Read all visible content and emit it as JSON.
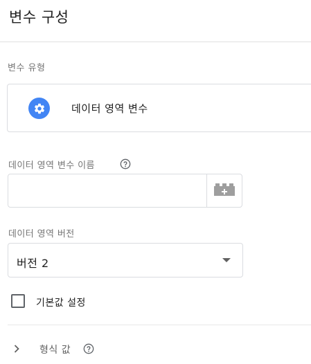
{
  "panel": {
    "title": "변수 구성"
  },
  "variable_type": {
    "section_label": "변수 유형",
    "selected_type": "데이터 영역 변수",
    "icon": "gear-icon",
    "icon_color": "#4285f4"
  },
  "data_layer_name": {
    "label": "데이터 영역 변수 이름",
    "value": "",
    "help_icon": "help-circle-icon",
    "picker_icon": "variable-brick-icon"
  },
  "data_layer_version": {
    "label": "데이터 영역 버전",
    "selected": "버전 2",
    "dropdown_icon": "dropdown-arrow-icon"
  },
  "default_value": {
    "label": "기본값 설정",
    "checked": false
  },
  "format_value": {
    "label": "형식 값",
    "icon": "chevron-right-icon",
    "help_icon": "help-circle-icon"
  }
}
